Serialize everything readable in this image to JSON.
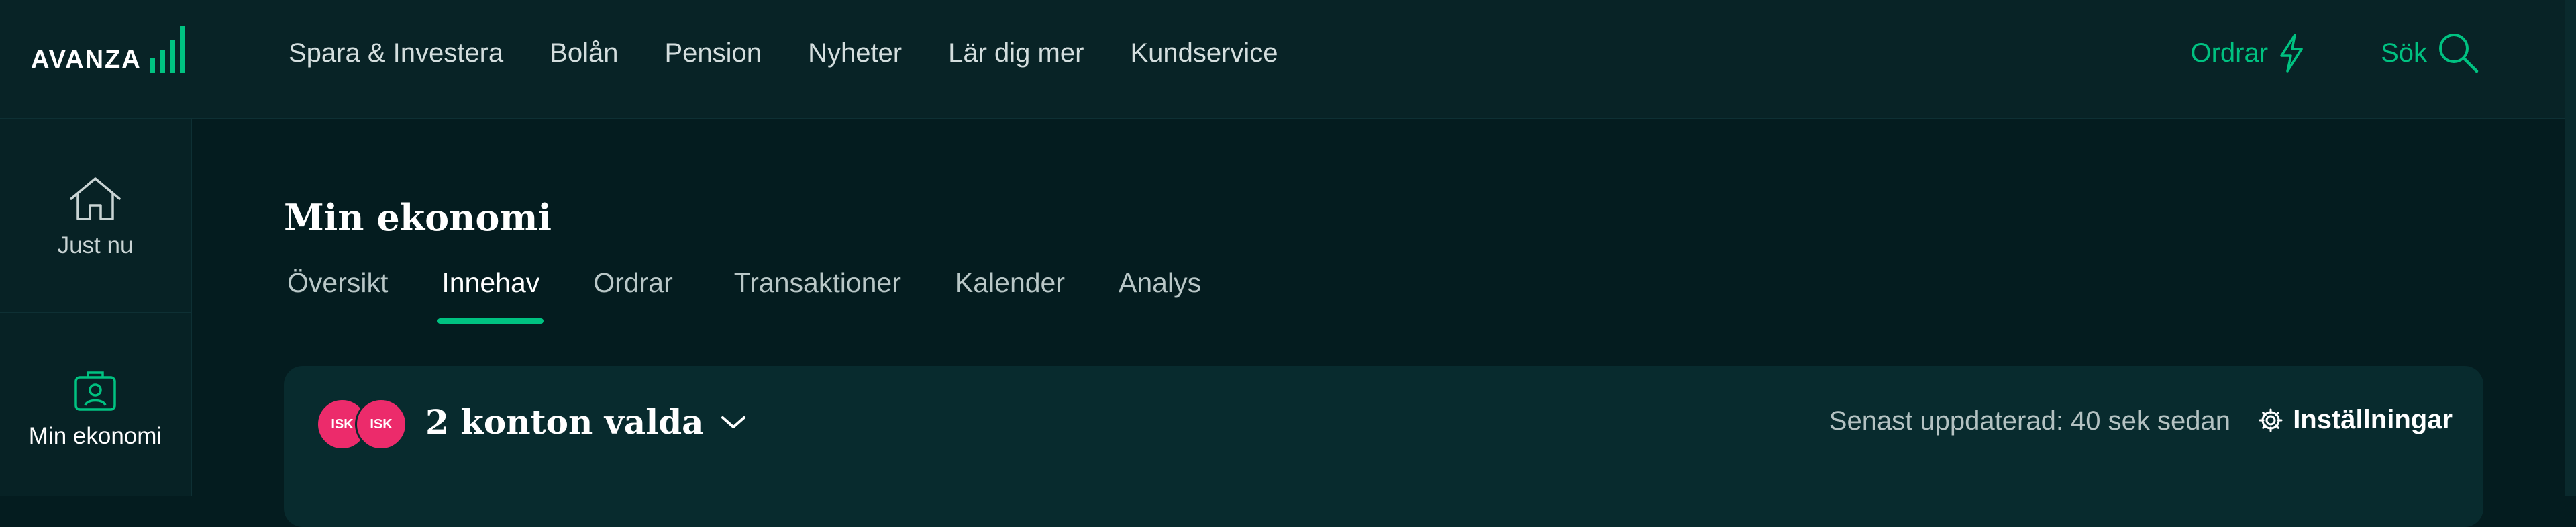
{
  "brand": {
    "name": "AVANZA",
    "accent_color": "#00c281"
  },
  "nav": {
    "items": [
      "Spara & Investera",
      "Bolån",
      "Pension",
      "Nyheter",
      "Lär dig mer",
      "Kundservice"
    ]
  },
  "top_actions": {
    "orders_label": "Ordrar",
    "orders_icon": "lightning-icon",
    "search_label": "Sök",
    "search_icon": "search-icon"
  },
  "sidebar": {
    "items": [
      {
        "label": "Just nu",
        "icon": "home-icon"
      },
      {
        "label": "Min ekonomi",
        "icon": "briefcase-icon",
        "active": true
      }
    ]
  },
  "page": {
    "title": "Min ekonomi",
    "tabs": [
      {
        "label": "Översikt"
      },
      {
        "label": "Innehav",
        "active": true
      },
      {
        "label": "Ordrar"
      },
      {
        "label": "Transaktioner"
      },
      {
        "label": "Kalender"
      },
      {
        "label": "Analys"
      }
    ]
  },
  "account_card": {
    "badges": [
      "ISK",
      "ISK"
    ],
    "badge_color": "#ec2b6b",
    "accounts_label": "2 konton valda",
    "updated_text": "Senast uppdaterad: 40 sek sedan",
    "settings_label": "Inställningar",
    "settings_icon": "gear-icon"
  }
}
